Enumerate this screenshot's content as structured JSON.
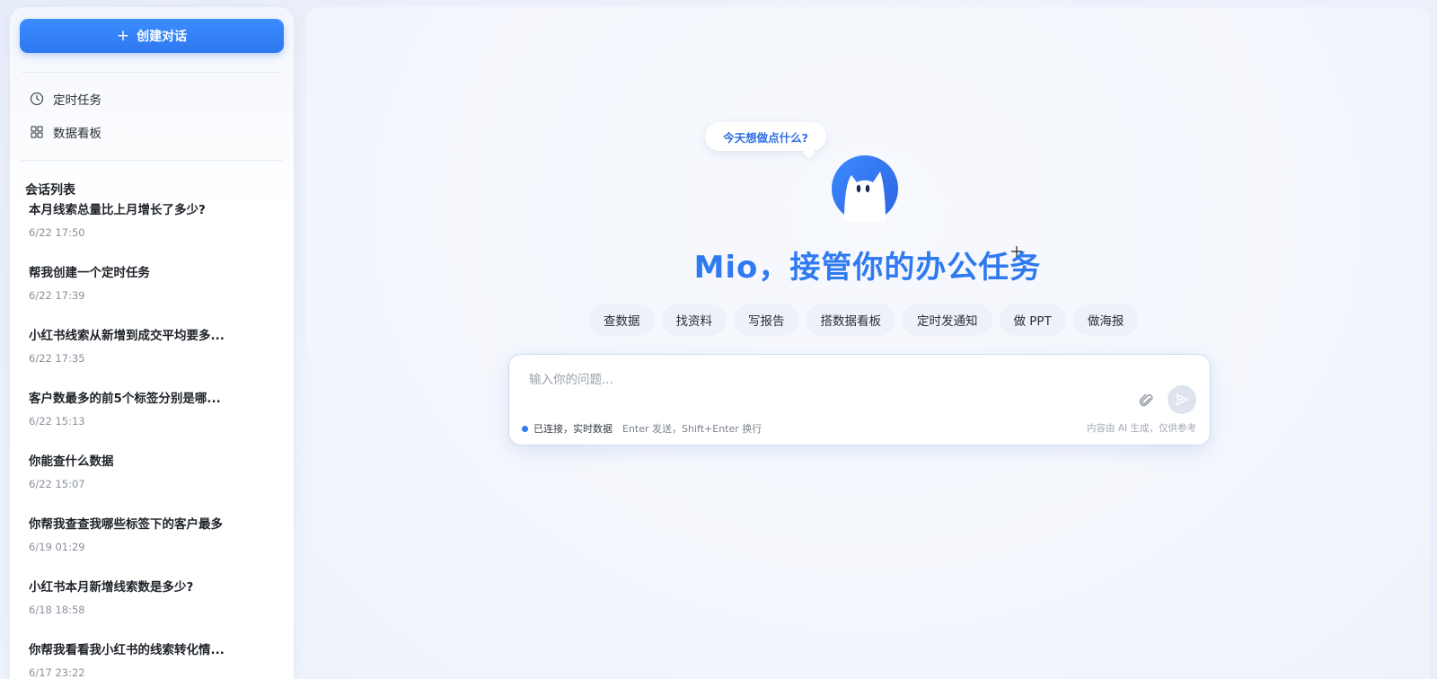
{
  "sidebar": {
    "new_chat_label": "创建对话",
    "nav": [
      {
        "label": "定时任务",
        "icon": "clock-icon"
      },
      {
        "label": "数据看板",
        "icon": "grid-icon"
      }
    ],
    "list_title": "会话列表",
    "conversations": [
      {
        "title": "本月线索总量比上月增长了多少?",
        "time": "6/22 17:50"
      },
      {
        "title": "帮我创建一个定时任务",
        "time": "6/22 17:39"
      },
      {
        "title": "小红书线索从新增到成交平均要多...",
        "time": "6/22 17:35"
      },
      {
        "title": "客户数最多的前5个标签分别是哪...",
        "time": "6/22 15:13"
      },
      {
        "title": "你能查什么数据",
        "time": "6/22 15:07"
      },
      {
        "title": "你帮我查查我哪些标签下的客户最多",
        "time": "6/19 01:29"
      },
      {
        "title": "小红书本月新增线索数是多少?",
        "time": "6/18 18:58"
      },
      {
        "title": "你帮我看看我小红书的线索转化情...",
        "time": "6/17 23:22"
      }
    ]
  },
  "main": {
    "bubble_text": "今天想做点什么?",
    "hero_title": "Mio，接管你的办公任务",
    "chips": [
      "查数据",
      "找资料",
      "写报告",
      "搭数据看板",
      "定时发通知",
      "做 PPT",
      "做海报"
    ],
    "input": {
      "placeholder": "输入你的问题...",
      "value": ""
    },
    "status_text": "已连接，实时数据",
    "hint_text": "Enter 发送，Shift+Enter 换行",
    "disclaimer": "内容由 AI 生成，仅供参考"
  },
  "colors": {
    "accent": "#2f7af0",
    "chip_bg": "#edf1f9",
    "send_btn_bg": "#dde4ee"
  }
}
